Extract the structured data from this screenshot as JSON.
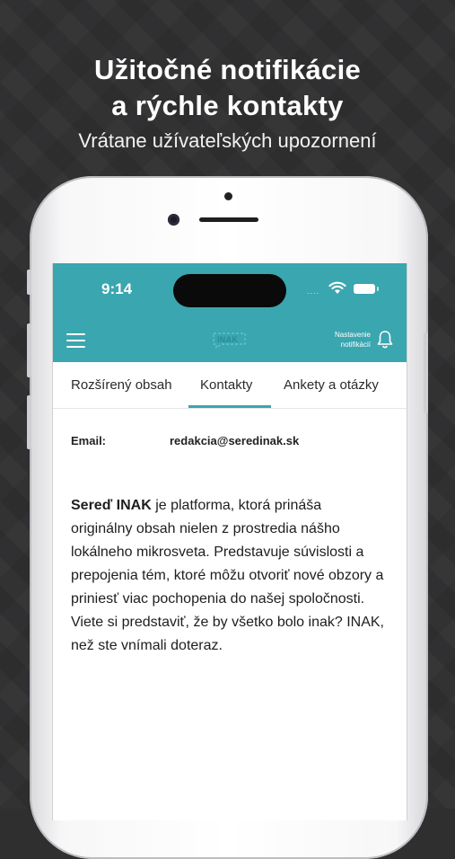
{
  "headline": {
    "line1": "Užitočné notifikácie",
    "line2": "a rýchle kontakty",
    "subtitle": "Vrátane užívateľských upozornení"
  },
  "status_bar": {
    "time": "9:14",
    "signal_dots": "....",
    "icons": [
      "wifi-icon",
      "battery-icon"
    ]
  },
  "app_header": {
    "menu_icon": "hamburger-menu-icon",
    "logo_text": "INAK",
    "settings_line1": "Nastavenie",
    "settings_line2": "notifikácií",
    "bell_icon": "bell-icon",
    "color": "#3aa6af"
  },
  "tabs": [
    {
      "label": "Rozšírený obsah"
    },
    {
      "label": "Kontakty",
      "active": true
    },
    {
      "label": "Ankety a otázky"
    }
  ],
  "contact": {
    "email_label": "Email:",
    "email_value": "redakcia@seredinak.sk"
  },
  "about": {
    "brand": "Sereď INAK",
    "text": " je platforma, ktorá prináša originálny obsah nielen z prostredia nášho lokálneho mikrosveta. Predstavuje súvislosti a prepojenia tém, ktoré môžu otvoriť nové obzory a priniesť viac pochopenia do našej spoločnosti. Viete si predstaviť, že by všetko bolo inak? INAK, než ste vnímali doteraz."
  }
}
